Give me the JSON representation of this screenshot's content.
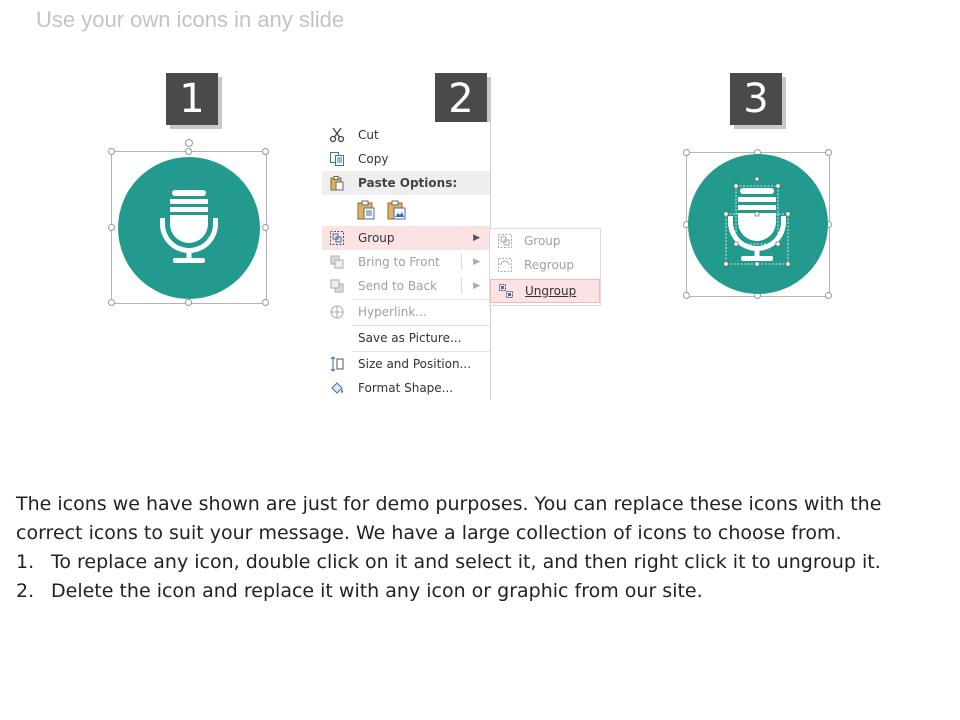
{
  "slide": {
    "title": "Use your own icons in any slide"
  },
  "steps": [
    "1",
    "2",
    "3"
  ],
  "colors": {
    "accent": "#239a8e",
    "badge": "#4a4a4a",
    "menu_highlight": "#fbe3e3"
  },
  "icons": {
    "step1": "microphone-icon",
    "step3": "microphone-icon"
  },
  "context_menu": {
    "cut": "Cut",
    "copy": "Copy",
    "paste_options": "Paste Options:",
    "group": "Group",
    "bring_to_front": "Bring to Front",
    "send_to_back": "Send to Back",
    "hyperlink": "Hyperlink...",
    "save_as_picture": "Save as Picture...",
    "size_and_position": "Size and Position...",
    "format_shape": "Format Shape..."
  },
  "submenu": {
    "group": "Group",
    "regroup": "Regroup",
    "ungroup": "Ungroup"
  },
  "instructions": {
    "intro": "The icons we have shown are just for demo purposes. You can replace these icons with the correct icons to suit your message. We have a large collection of icons to choose from.",
    "items": [
      {
        "num": "1.",
        "text": "To replace any icon, double click on it and select it, and then right click it to ungroup it."
      },
      {
        "num": "2.",
        "text": "Delete the icon and replace it with any icon or graphic from our site."
      }
    ]
  }
}
